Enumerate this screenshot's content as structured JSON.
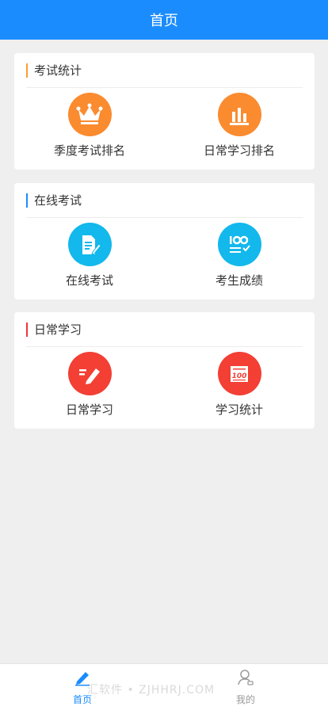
{
  "header": {
    "title": "首页"
  },
  "sections": [
    {
      "title": "考试统计",
      "accent": "#ff9b2f",
      "items": [
        {
          "label": "季度考试排名",
          "icon": "crown-icon",
          "color": "#fb8b2f"
        },
        {
          "label": "日常学习排名",
          "icon": "bar-chart-icon",
          "color": "#fb8b2f"
        }
      ]
    },
    {
      "title": "在线考试",
      "accent": "#1a8cfe",
      "items": [
        {
          "label": "在线考试",
          "icon": "exam-paper-icon",
          "color": "#13b8ec"
        },
        {
          "label": "考生成绩",
          "icon": "score-icon",
          "color": "#13b8ec"
        }
      ]
    },
    {
      "title": "日常学习",
      "accent": "#f2353b",
      "items": [
        {
          "label": "日常学习",
          "icon": "pencil-icon",
          "color": "#f33f34"
        },
        {
          "label": "学习统计",
          "icon": "score-100-icon",
          "color": "#f33f34"
        }
      ]
    }
  ],
  "tabbar": {
    "active_color": "#1a8cfe",
    "inactive_color": "#9a9a9a",
    "items": [
      {
        "label": "首页",
        "icon": "edit-icon",
        "active": true
      },
      {
        "label": "我的",
        "icon": "user-icon",
        "active": false
      }
    ]
  },
  "watermark": "汇软件 • ZJHHRJ.COM"
}
